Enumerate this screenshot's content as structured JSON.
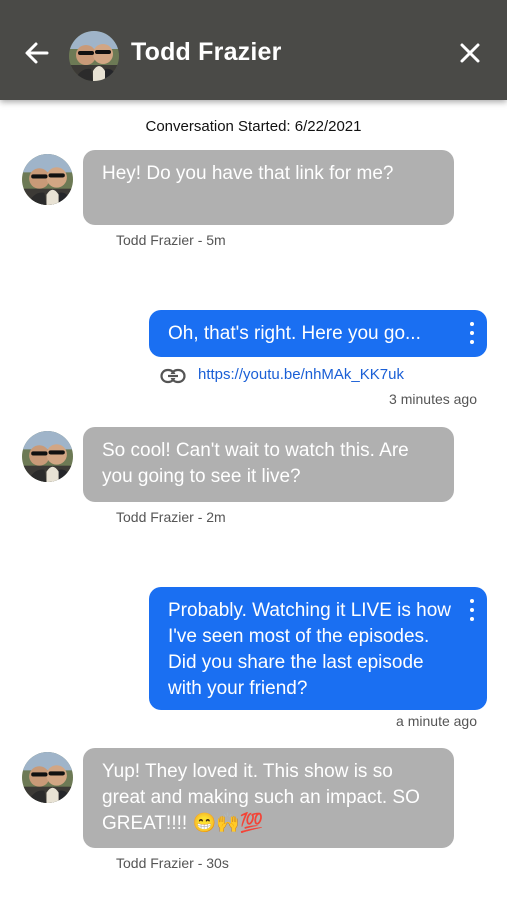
{
  "header": {
    "title": "Todd Frazier",
    "back_icon": "arrow-left-icon",
    "close_icon": "close-icon",
    "background": "#4a4a47"
  },
  "conversation": {
    "started_label": "Conversation Started: 6/22/2021"
  },
  "messages": [
    {
      "direction": "incoming",
      "text": "Hey!  Do you have that link for me?",
      "meta": "Todd Frazier - 5m"
    },
    {
      "direction": "outgoing",
      "text": "Oh, that's right. Here you go...",
      "link": "https://youtu.be/nhMAk_KK7uk",
      "meta": "3 minutes ago"
    },
    {
      "direction": "incoming",
      "text": "So cool!  Can't wait to watch this. Are you going to see it live?",
      "meta": "Todd Frazier - 2m"
    },
    {
      "direction": "outgoing",
      "text": "Probably. Watching it LIVE is how I've seen most of the episodes. Did you share the last episode with your friend?",
      "meta": "a minute ago"
    },
    {
      "direction": "incoming",
      "text": "Yup!  They loved it. This show is so great and making such an impact. SO GREAT!!!!",
      "emoji": "😁🙌💯",
      "meta": "Todd Frazier - 30s"
    }
  ],
  "colors": {
    "incoming_bubble": "#b0b0b0",
    "outgoing_bubble": "#1a6ff2",
    "link": "#1a5fd6"
  }
}
